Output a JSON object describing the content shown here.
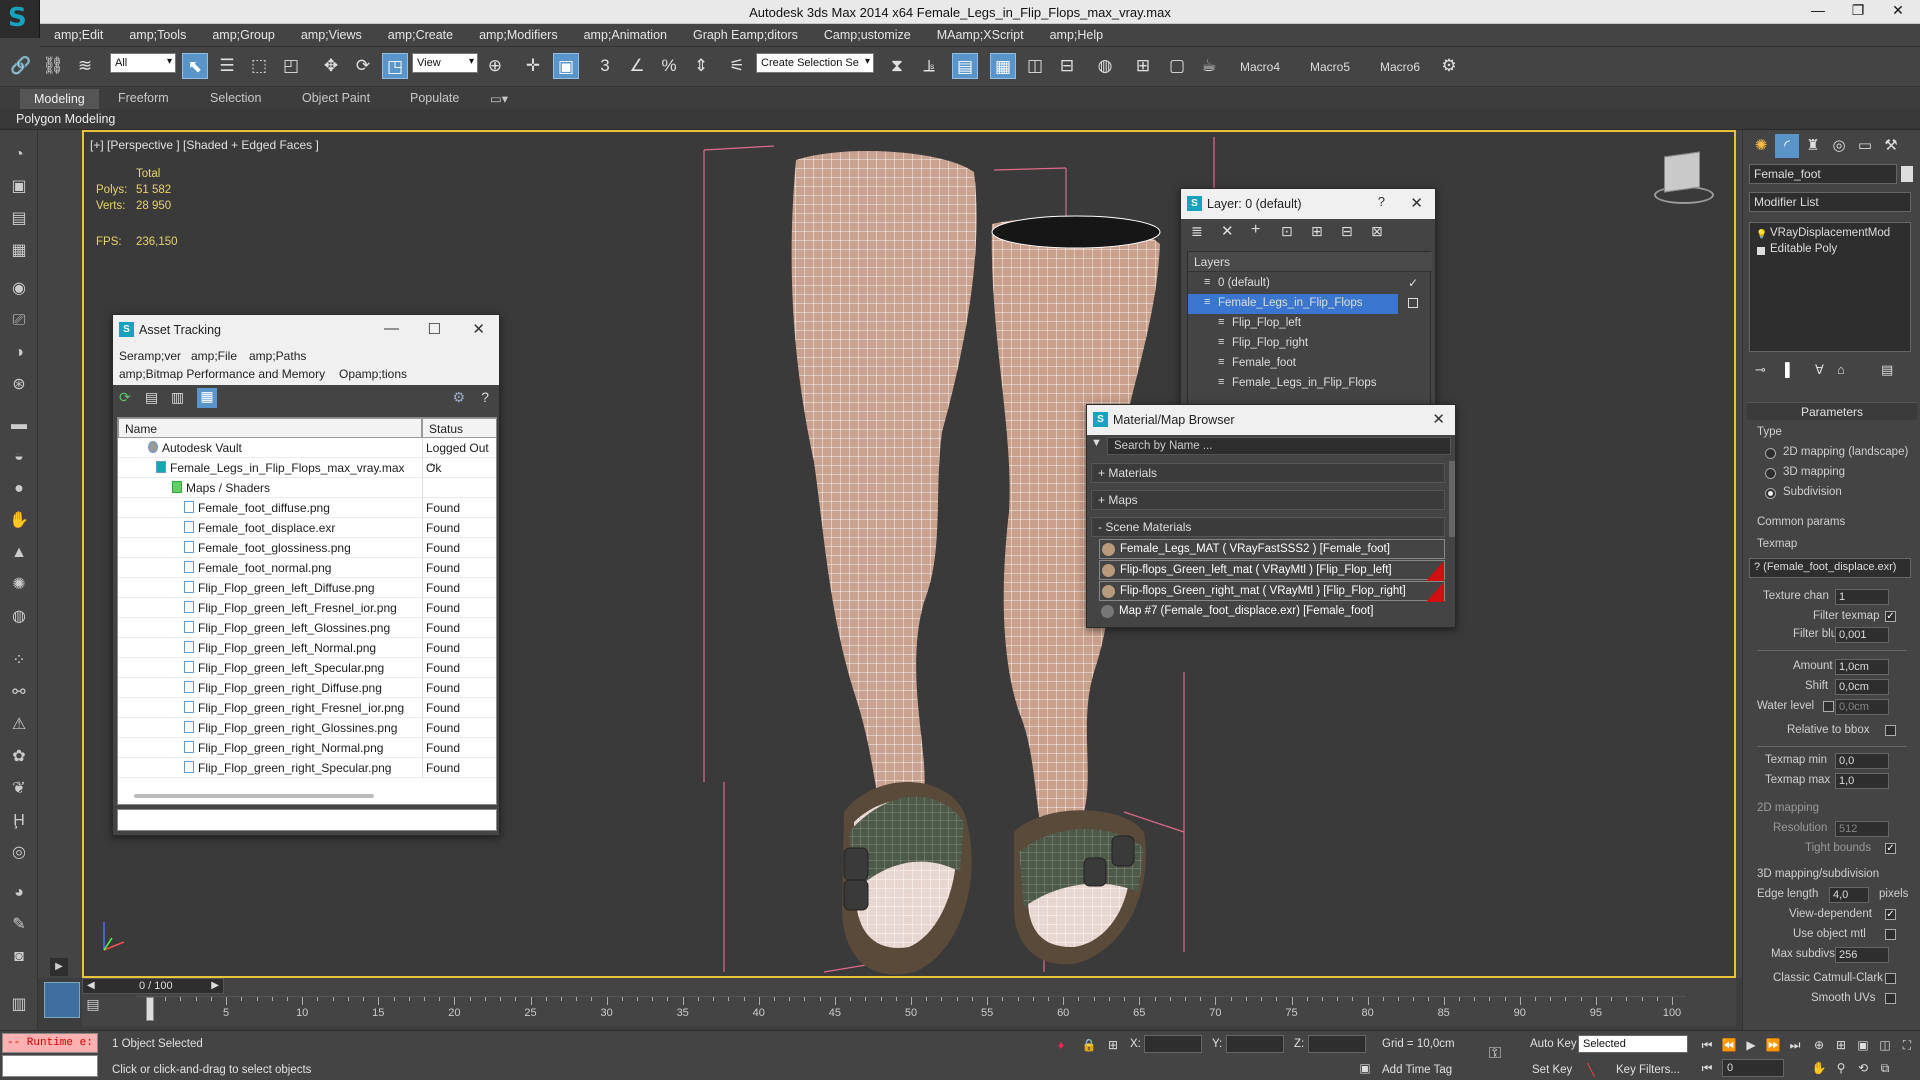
{
  "window": {
    "title": "Autodesk 3ds Max  2014 x64     Female_Legs_in_Flip_Flops_max_vray.max"
  },
  "menu": [
    "amp;Edit",
    "amp;Tools",
    "amp;Group",
    "amp;Views",
    "amp;Create",
    "amp;Modifiers",
    "amp;Animation",
    "Graph Eamp;ditors",
    "Camp;ustomize",
    "MAamp;XScript",
    "amp;Help"
  ],
  "toolbar": {
    "selection_filter": "All",
    "ref_coord": "View",
    "named_selection": "Create Selection Se",
    "macros": [
      "Macro4",
      "Macro5",
      "Macro6"
    ]
  },
  "ribbon": {
    "tabs": [
      "Modeling",
      "Freeform",
      "Selection",
      "Object Paint",
      "Populate"
    ],
    "panel": "Polygon Modeling"
  },
  "viewport": {
    "label": "[+] [Perspective ] [Shaded + Edged Faces ]",
    "stats": {
      "total_label": "Total",
      "polys_label": "Polys:",
      "polys": "51 582",
      "verts_label": "Verts:",
      "verts": "28 950",
      "fps_label": "FPS:",
      "fps": "236,150"
    }
  },
  "asset_tracking": {
    "title": "Asset Tracking",
    "menu": [
      "Seramp;ver",
      "amp;File",
      "amp;Paths",
      "amp;Bitmap Performance and Memory",
      "Opamp;tions"
    ],
    "col_name": "Name",
    "col_status": "Status",
    "rows": [
      {
        "name": "Autodesk Vault",
        "status": "Logged Out ..."
      },
      {
        "name": "Female_Legs_in_Flip_Flops_max_vray.max",
        "status": "Ok"
      },
      {
        "name": "Maps / Shaders",
        "status": ""
      },
      {
        "name": "Female_foot_diffuse.png",
        "status": "Found"
      },
      {
        "name": "Female_foot_displace.exr",
        "status": "Found"
      },
      {
        "name": "Female_foot_glossiness.png",
        "status": "Found"
      },
      {
        "name": "Female_foot_normal.png",
        "status": "Found"
      },
      {
        "name": "Flip_Flop_green_left_Diffuse.png",
        "status": "Found"
      },
      {
        "name": "Flip_Flop_green_left_Fresnel_ior.png",
        "status": "Found"
      },
      {
        "name": "Flip_Flop_green_left_Glossines.png",
        "status": "Found"
      },
      {
        "name": "Flip_Flop_green_left_Normal.png",
        "status": "Found"
      },
      {
        "name": "Flip_Flop_green_left_Specular.png",
        "status": "Found"
      },
      {
        "name": "Flip_Flop_green_right_Diffuse.png",
        "status": "Found"
      },
      {
        "name": "Flip_Flop_green_right_Fresnel_ior.png",
        "status": "Found"
      },
      {
        "name": "Flip_Flop_green_right_Glossines.png",
        "status": "Found"
      },
      {
        "name": "Flip_Flop_green_right_Normal.png",
        "status": "Found"
      },
      {
        "name": "Flip_Flop_green_right_Specular.png",
        "status": "Found"
      }
    ]
  },
  "layer_dialog": {
    "title": "Layer: 0 (default)",
    "help": "?",
    "header": "Layers",
    "items": [
      "0 (default)",
      "Female_Legs_in_Flip_Flops",
      "Flip_Flop_left",
      "Flip_Flop_right",
      "Female_foot",
      "Female_Legs_in_Flip_Flops"
    ]
  },
  "material_browser": {
    "title": "Material/Map Browser",
    "search_placeholder": "Search by Name ...",
    "groups": [
      "+ Materials",
      "+ Maps",
      "- Scene Materials"
    ],
    "items": [
      "Female_Legs_MAT ( VRayFastSSS2 ) [Female_foot]",
      "Flip-flops_Green_left_mat ( VRayMtl ) [Flip_Flop_left]",
      "Flip-flops_Green_right_mat ( VRayMtl ) [Flip_Flop_right]",
      "Map #7 (Female_foot_displace.exr) [Female_foot]"
    ]
  },
  "command_panel": {
    "object_name": "Female_foot",
    "modifier_list": "Modifier List",
    "stack": [
      "VRayDisplacementMod",
      "Editable Poly"
    ],
    "parameters": "Parameters",
    "type_label": "Type",
    "types": [
      "2D mapping (landscape)",
      "3D mapping",
      "Subdivision"
    ],
    "common_params": "Common params",
    "texmap_label": "Texmap",
    "texmap": "? (Female_foot_displace.exr)",
    "texture_chan_label": "Texture chan",
    "texture_chan": "1",
    "filter_texmap": "Filter texmap",
    "filter_blur_label": "Filter blur",
    "filter_blur": "0,001",
    "amount_label": "Amount",
    "amount": "1,0cm",
    "shift_label": "Shift",
    "shift": "0,0cm",
    "water_level_label": "Water level",
    "water_level": "0,0cm",
    "relative_bbox": "Relative to bbox",
    "texmap_min_label": "Texmap min",
    "texmap_min": "0,0",
    "texmap_max_label": "Texmap max",
    "texmap_max": "1,0",
    "mapping2d": "2D mapping",
    "resolution_label": "Resolution",
    "resolution": "512",
    "tight_bounds": "Tight bounds",
    "mapping3d": "3D mapping/subdivision",
    "edge_length_label": "Edge length",
    "edge_length": "4,0",
    "pixels": "pixels",
    "view_dependent": "View-dependent",
    "use_object_mtl": "Use object mtl",
    "max_subdivs_label": "Max subdivs",
    "max_subdivs": "256",
    "classic_catmull": "Classic Catmull-Clark",
    "smooth_uvs": "Smooth UVs"
  },
  "timeline": {
    "frame": "0 / 100",
    "ticks": [
      "0",
      "5",
      "10",
      "15",
      "20",
      "25",
      "30",
      "35",
      "40",
      "45",
      "50",
      "55",
      "60",
      "65",
      "70",
      "75",
      "80",
      "85",
      "90",
      "95",
      "100"
    ]
  },
  "status": {
    "maxscript": "-- Runtime e:",
    "selected": "1 Object Selected",
    "prompt": "Click or click-and-drag to select objects",
    "x_label": "X:",
    "y_label": "Y:",
    "z_label": "Z:",
    "grid": "Grid = 10,0cm",
    "add_time_tag": "Add Time Tag",
    "auto_key": "Auto Key",
    "set_key": "Set Key",
    "key_mode": "Selected",
    "key_filters": "Key Filters...",
    "frame_value": "0"
  },
  "colors": {
    "accent": "#5a95c9",
    "selection": "#3a76cf",
    "viewport_border": "#e7c23a",
    "stats": "#e7d36a",
    "error_bg": "#ffb0b0"
  }
}
